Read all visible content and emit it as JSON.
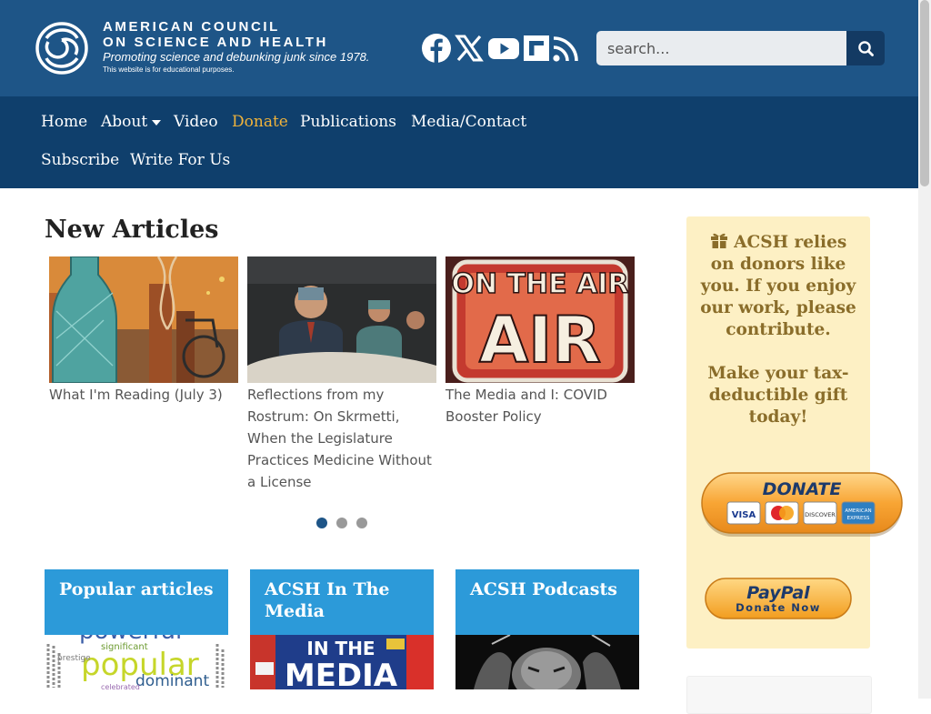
{
  "header": {
    "logo_line1": "AMERICAN COUNCIL",
    "logo_line2": "ON SCIENCE AND HEALTH",
    "tagline": "Promoting science and debunking junk since 1978.",
    "disclaimer": "This website is for educational purposes.",
    "social_icons": [
      "facebook-icon",
      "x-icon",
      "youtube-icon",
      "flipboard-icon",
      "rss-icon"
    ],
    "search": {
      "placeholder": "search..."
    }
  },
  "nav": {
    "items": [
      {
        "label": "Home"
      },
      {
        "label": "About"
      },
      {
        "label": "Video"
      },
      {
        "label": "Donate",
        "active": true
      },
      {
        "label": "Publications"
      },
      {
        "label": "Media/Contact"
      },
      {
        "label": "Subscribe"
      },
      {
        "label": "Write For Us"
      }
    ]
  },
  "main": {
    "section_title": "New Articles",
    "articles": [
      {
        "title": "What I'm Reading (July 3)"
      },
      {
        "title": "Reflections from my Rostrum: On Skrmetti, When the Legislature Practices Medicine Without a License"
      },
      {
        "title": "The Media and I: COVID Booster Policy",
        "image_text": "ON THE AIR"
      }
    ],
    "carousel": {
      "pages": 3,
      "active": 1
    },
    "cards": [
      {
        "title": "Popular articles",
        "image_words": [
          "powerful",
          "popular",
          "dominant",
          "significant",
          "prestige",
          "celebrated"
        ]
      },
      {
        "title": "ACSH In The Media",
        "image_text_1": "IN THE",
        "image_text_2": "MEDIA"
      },
      {
        "title": "ACSH Podcasts"
      }
    ]
  },
  "sidebar": {
    "appeal": "ACSH relies on donors like you. If you enjoy our work, please contribute.",
    "gift": "Make your tax-deductible gift today!",
    "donate_label": "DONATE",
    "cards": [
      "VISA",
      "MasterCard",
      "DISCOVER",
      "AMERICAN EXPRESS"
    ],
    "paypal_label_1": "PayPal",
    "paypal_label_2": "Donate Now"
  },
  "colors": {
    "header": "#1e5587",
    "nav": "#0f3f6c",
    "nav_active": "#f0b33b",
    "card_header": "#2c9ad9",
    "donor_box": "#fdf0c4",
    "donor_text": "#8a6d2a"
  }
}
